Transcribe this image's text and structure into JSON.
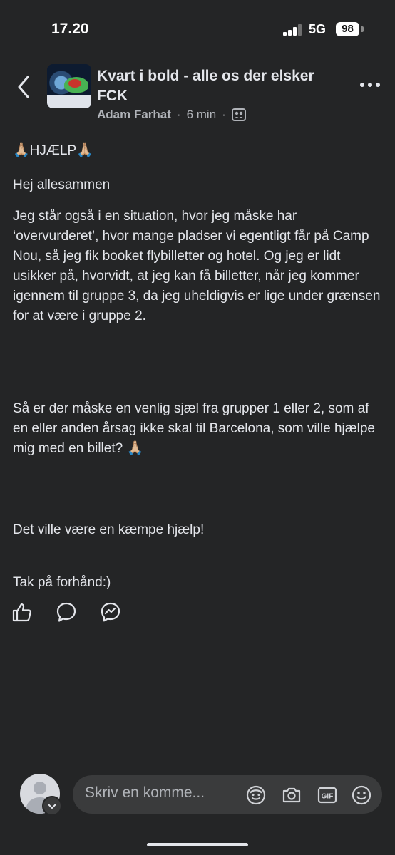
{
  "status_bar": {
    "time": "17.20",
    "network": "5G",
    "battery": "98"
  },
  "header": {
    "group_title": "Kvart i bold - alle os der elsker FCK",
    "author": "Adam Farhat",
    "separator": "·",
    "time_ago": "6 min"
  },
  "post": {
    "headline": "🙏🏼HJÆLP🙏🏼",
    "greeting": "Hej allesammen",
    "paragraph_1": "Jeg står også i en situation, hvor jeg måske har ‘overvurderet’, hvor mange pladser vi egentligt får på Camp Nou, så jeg fik booket flybilletter og hotel. Og jeg er lidt usikker på, hvorvidt, at jeg kan få billetter, når jeg kommer igennem til gruppe 3, da jeg uheldigvis er lige under grænsen for at være i gruppe 2.",
    "paragraph_2": "Så er der måske en venlig sjæl fra grupper 1 eller 2, som af en eller anden årsag ikke skal til Barcelona, som ville hjælpe mig med en billet? 🙏🏼",
    "paragraph_3": "Det ville være en kæmpe hjælp!",
    "paragraph_4": "Tak på forhånd:)"
  },
  "actions": [
    "like-icon",
    "comment-icon",
    "messenger-icon"
  ],
  "comment_bar": {
    "placeholder": "Skriv en komme...",
    "icons": [
      "avatar-sticker-icon",
      "camera-icon",
      "gif-icon",
      "emoji-icon"
    ]
  },
  "colors": {
    "background": "#242526",
    "text": "#e4e6eb",
    "secondary": "#b0b3b8",
    "field": "#3a3b3c"
  }
}
